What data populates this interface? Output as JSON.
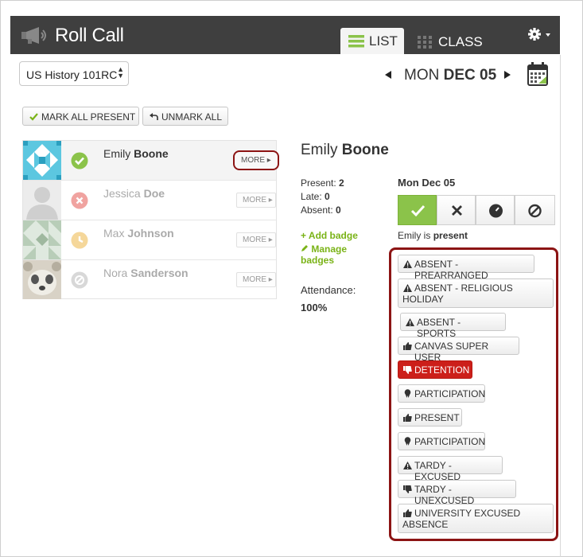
{
  "app": {
    "title": "Roll Call"
  },
  "tabs": {
    "list": "LIST",
    "class": "CLASS"
  },
  "course": {
    "selected": "US History 101RC"
  },
  "date": {
    "day": "MON",
    "date": "DEC 05"
  },
  "actions": {
    "mark_all": "MARK ALL PRESENT",
    "unmark_all": "UNMARK ALL"
  },
  "students": [
    {
      "first": "Emily",
      "last": "Boone",
      "status": "present",
      "more": "MORE ▸"
    },
    {
      "first": "Jessica",
      "last": "Doe",
      "status": "absent",
      "more": "MORE ▸"
    },
    {
      "first": "Max",
      "last": "Johnson",
      "status": "late",
      "more": "MORE ▸"
    },
    {
      "first": "Nora",
      "last": "Sanderson",
      "status": "unmarked",
      "more": "MORE ▸"
    }
  ],
  "detail": {
    "first": "Emily",
    "last": "Boone",
    "present_label": "Present:",
    "present": "2",
    "late_label": "Late:",
    "late": "0",
    "absent_label": "Absent:",
    "absent": "0",
    "add_badge": "+ Add badge",
    "manage_1": "Manage",
    "manage_2": "badges",
    "attendance_label": "Attendance:",
    "attendance": "100%",
    "day_title": "Mon Dec 05",
    "status_prefix": "Emily is",
    "status_word": "present"
  },
  "badges": [
    {
      "line1": "ABSENT - PREARRANGED",
      "icon": "warning"
    },
    {
      "line1": "ABSENT - RELIGIOUS",
      "line2": "HOLIDAY",
      "icon": "warning"
    },
    {
      "line1": "ABSENT - SPORTS",
      "icon": "warning"
    },
    {
      "line1": "CANVAS SUPER USER",
      "icon": "thumbs-up"
    },
    {
      "line1": "DETENTION",
      "icon": "thumbs-down",
      "active": true
    },
    {
      "line1": "PARTICIPATION",
      "icon": "ribbon"
    },
    {
      "line1": "PRESENT",
      "icon": "thumbs-up"
    },
    {
      "line1": "PARTICIPATION",
      "icon": "ribbon"
    },
    {
      "line1": "TARDY - EXCUSED",
      "icon": "warning"
    },
    {
      "line1": "TARDY - UNEXCUSED",
      "icon": "thumbs-down"
    },
    {
      "line1": "UNIVERSITY EXCUSED",
      "line2": "ABSENCE",
      "icon": "thumbs-up"
    }
  ],
  "colors": {
    "accent_green": "#8bc34a",
    "link_green": "#7ab317",
    "highlight_red": "#8c1414",
    "detention_red": "#cc1f1a",
    "header": "#3f3f3f"
  }
}
